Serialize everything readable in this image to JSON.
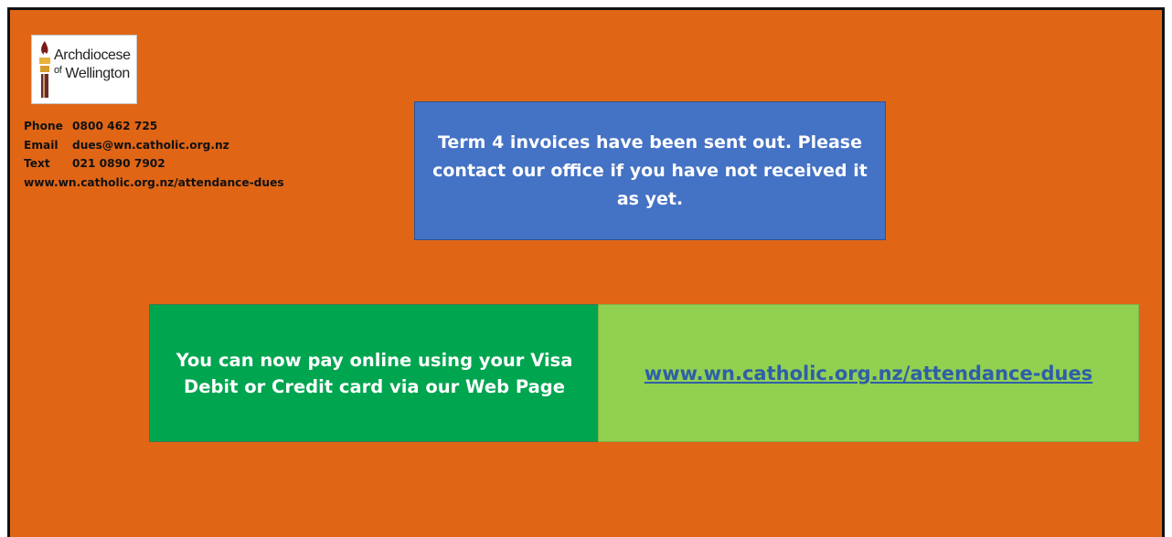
{
  "logo": {
    "line1": "Archdiocese",
    "line2_small": "of",
    "line2": "Wellington"
  },
  "contact": [
    {
      "label": "Phone",
      "value": "0800 462 725"
    },
    {
      "label": "Email",
      "value": "dues@wn.catholic.org.nz"
    },
    {
      "label": "Text",
      "value": "021 0890 7902"
    },
    {
      "label": "",
      "value": "www.wn.catholic.org.nz/attendance-dues"
    }
  ],
  "notice": {
    "text": "Term 4 invoices have been sent out. Please contact our office if you have not received it as yet."
  },
  "payment": {
    "text": "You can now pay online using your Visa Debit or Credit card via our Web Page",
    "link": "www.wn.catholic.org.nz/attendance-dues"
  },
  "colors": {
    "background": "#e06616",
    "notice": "#4472c4",
    "payment_left": "#00a550",
    "payment_right": "#92d050",
    "link": "#2e5fa8"
  }
}
